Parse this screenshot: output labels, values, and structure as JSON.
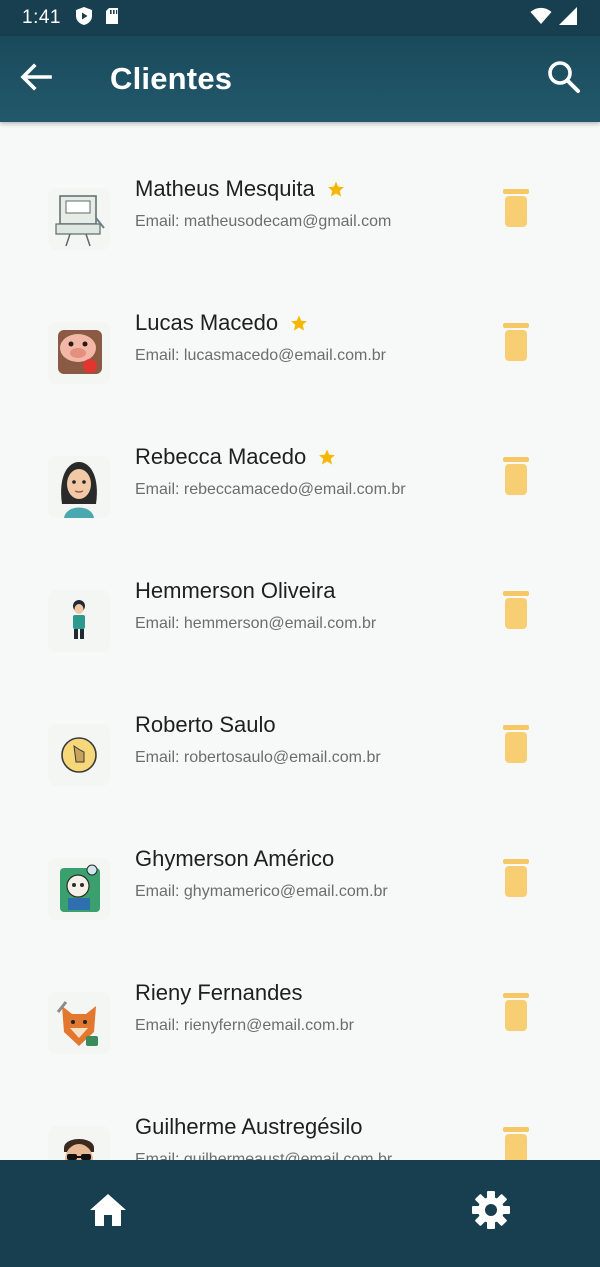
{
  "status_bar": {
    "time": "1:41",
    "icons": [
      "shield-play-icon",
      "sd-card-icon",
      "wifi-icon",
      "signal-icon"
    ]
  },
  "app_bar": {
    "title": "Clientes",
    "back_icon": "arrow-left-icon",
    "search_icon": "search-icon"
  },
  "clients": [
    {
      "name": "Matheus Mesquita",
      "email": "Email: matheusodecam@gmail.com",
      "favorite": true,
      "avatar": "sketch-computer-avatar"
    },
    {
      "name": "Lucas Macedo",
      "email": "Email: lucasmacedo@email.com.br",
      "favorite": true,
      "avatar": "cartoon-pig-avatar"
    },
    {
      "name": "Rebecca Macedo",
      "email": "Email: rebeccamacedo@email.com.br",
      "favorite": true,
      "avatar": "woman-avatar"
    },
    {
      "name": "Hemmerson Oliveira",
      "email": "Email: hemmerson@email.com.br",
      "favorite": false,
      "avatar": "small-person-avatar"
    },
    {
      "name": "Roberto Saulo",
      "email": "Email: robertosaulo@email.com.br",
      "favorite": false,
      "avatar": "round-badge-avatar"
    },
    {
      "name": "Ghymerson Américo",
      "email": "Email: ghymamerico@email.com.br",
      "favorite": false,
      "avatar": "cartoon-character-avatar"
    },
    {
      "name": "Rieny Fernandes",
      "email": "Email: rienyfern@email.com.br",
      "favorite": false,
      "avatar": "cartoon-fox-avatar"
    },
    {
      "name": "Guilherme Austregésilo",
      "email": "Email: guilhermeaust@email.com.br",
      "favorite": false,
      "avatar": "man-sunglasses-avatar"
    }
  ],
  "bottom_nav": {
    "items": [
      "home-icon",
      "settings-icon"
    ]
  },
  "colors": {
    "app_bar": "#1a4a5c",
    "bottom_nav": "#173f4f",
    "background": "#f7f8f8",
    "star": "#f5b800",
    "trash": "#f7cf72"
  }
}
